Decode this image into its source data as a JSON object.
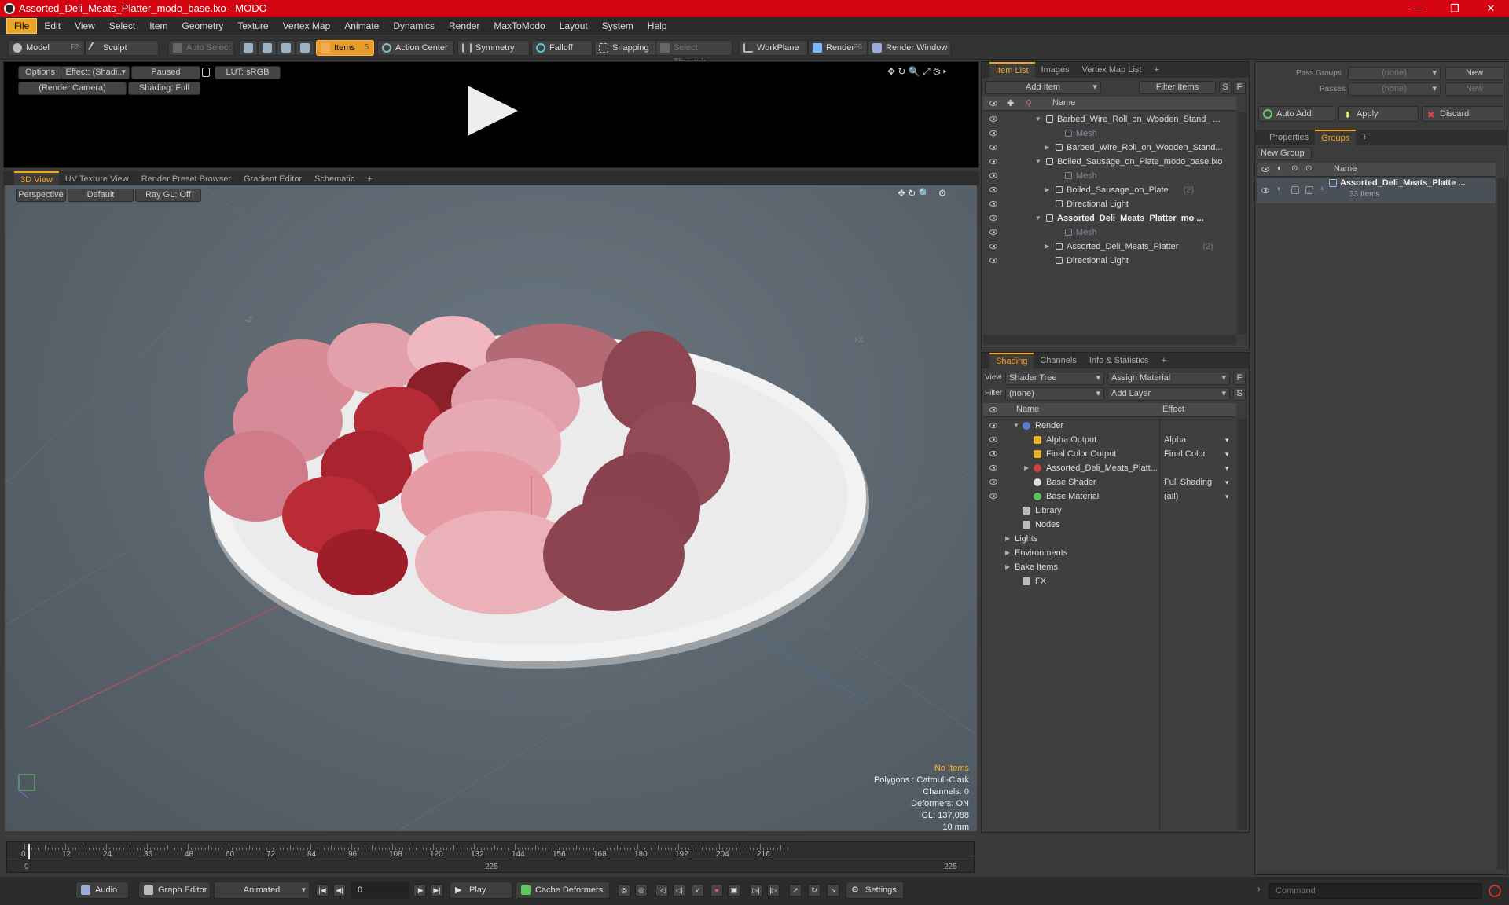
{
  "window": {
    "title": "Assorted_Deli_Meats_Platter_modo_base.lxo - MODO",
    "controls": [
      "—",
      "❐",
      "✕"
    ]
  },
  "menu": [
    "File",
    "Edit",
    "View",
    "Select",
    "Item",
    "Geometry",
    "Texture",
    "Vertex Map",
    "Animate",
    "Dynamics",
    "Render",
    "MaxToModo",
    "Layout",
    "System",
    "Help"
  ],
  "toolbar": {
    "model": "Model",
    "model_key": "F2",
    "sculpt": "Sculpt",
    "auto_select": "Auto Select",
    "items": "Items",
    "items_key": "5",
    "action_center": "Action Center",
    "symmetry": "Symmetry",
    "falloff": "Falloff",
    "snapping": "Snapping",
    "select_through": "Select Through",
    "workplane": "WorkPlane",
    "render": "Render",
    "render_key": "F9",
    "render_window": "Render Window"
  },
  "preview": {
    "options": "Options",
    "effect": "Effect: (Shadi...",
    "paused": "Paused",
    "lut": "LUT: sRGB",
    "camera": "(Render Camera)",
    "shading": "Shading: Full"
  },
  "viewtabs": [
    "3D View",
    "UV Texture View",
    "Render Preset Browser",
    "Gradient Editor",
    "Schematic",
    "+"
  ],
  "viewport": {
    "perspective": "Perspective",
    "default": "Default",
    "raygl": "Ray GL: Off",
    "axis_z": "-Z",
    "axis_x": "+X",
    "stats": {
      "no_items": "No Items",
      "polygons": "Polygons : Catmull-Clark",
      "channels": "Channels: 0",
      "deformers": "Deformers: ON",
      "gl": "GL: 137,088",
      "unit": "10 mm"
    }
  },
  "timeline": {
    "ticks": [
      "0",
      "12",
      "24",
      "36",
      "48",
      "60",
      "72",
      "84",
      "96",
      "108",
      "120",
      "132",
      "144",
      "156",
      "168",
      "180",
      "192",
      "204",
      "216"
    ],
    "start": "0",
    "mid": "225",
    "end": "225"
  },
  "bottom": {
    "audio": "Audio",
    "graph_editor": "Graph Editor",
    "animated": "Animated",
    "frame": "0",
    "play": "Play",
    "cache_deformers": "Cache Deformers",
    "settings": "Settings",
    "command_placeholder": "Command"
  },
  "itemlist": {
    "tabs": [
      "Item List",
      "Images",
      "Vertex Map List",
      "+"
    ],
    "add_item": "Add Item",
    "filter_items": "Filter Items",
    "col_name": "Name",
    "rows": [
      {
        "label": "Barbed_Wire_Roll_on_Wooden_Stand_ ...",
        "indent": 0,
        "arrow": "▼",
        "dim": false,
        "bold": false,
        "count": ""
      },
      {
        "label": "Mesh",
        "indent": 2,
        "arrow": "",
        "dim": true,
        "bold": false,
        "count": ""
      },
      {
        "label": "Barbed_Wire_Roll_on_Wooden_Stand...",
        "indent": 1,
        "arrow": "▶",
        "dim": false,
        "bold": false,
        "count": ""
      },
      {
        "label": "Boiled_Sausage_on_Plate_modo_base.lxo",
        "indent": 0,
        "arrow": "▼",
        "dim": false,
        "bold": false,
        "count": ""
      },
      {
        "label": "Mesh",
        "indent": 2,
        "arrow": "",
        "dim": true,
        "bold": false,
        "count": ""
      },
      {
        "label": "Boiled_Sausage_on_Plate",
        "indent": 1,
        "arrow": "▶",
        "dim": false,
        "bold": false,
        "count": "(2)"
      },
      {
        "label": "Directional Light",
        "indent": 1,
        "arrow": "",
        "dim": false,
        "bold": false,
        "count": ""
      },
      {
        "label": "Assorted_Deli_Meats_Platter_mo ...",
        "indent": 0,
        "arrow": "▼",
        "dim": false,
        "bold": true,
        "count": ""
      },
      {
        "label": "Mesh",
        "indent": 2,
        "arrow": "",
        "dim": true,
        "bold": false,
        "count": ""
      },
      {
        "label": "Assorted_Deli_Meats_Platter",
        "indent": 1,
        "arrow": "▶",
        "dim": false,
        "bold": false,
        "count": "(2)"
      },
      {
        "label": "Directional Light",
        "indent": 1,
        "arrow": "",
        "dim": false,
        "bold": false,
        "count": ""
      }
    ]
  },
  "shading": {
    "tabs": [
      "Shading",
      "Channels",
      "Info & Statistics",
      "+"
    ],
    "view_label": "View",
    "view_value": "Shader Tree",
    "assign_material": "Assign Material",
    "filter_label": "Filter",
    "filter_value": "(none)",
    "add_layer": "Add Layer",
    "col_name": "Name",
    "col_effect": "Effect",
    "rows": [
      {
        "label": "Render",
        "effect": "",
        "indent": 0
      },
      {
        "label": "Alpha Output",
        "effect": "Alpha",
        "indent": 1
      },
      {
        "label": "Final Color Output",
        "effect": "Final Color",
        "indent": 1
      },
      {
        "label": "Assorted_Deli_Meats_Platt...",
        "effect": "",
        "indent": 1
      },
      {
        "label": "Base Shader",
        "effect": "Full Shading",
        "indent": 1
      },
      {
        "label": "Base Material",
        "effect": "(all)",
        "indent": 1
      },
      {
        "label": "Library",
        "effect": "",
        "indent": 0
      },
      {
        "label": "Nodes",
        "effect": "",
        "indent": 0
      },
      {
        "label": "Lights",
        "effect": "",
        "indent": -1
      },
      {
        "label": "Environments",
        "effect": "",
        "indent": -1
      },
      {
        "label": "Bake Items",
        "effect": "",
        "indent": -1
      },
      {
        "label": "FX",
        "effect": "",
        "indent": 0
      }
    ]
  },
  "groups": {
    "pass_groups": "Pass Groups",
    "passes": "Passes",
    "none": "(none)",
    "new": "New",
    "auto_add": "Auto Add",
    "apply": "Apply",
    "discard": "Discard",
    "tabs": [
      "Properties",
      "Groups",
      "+"
    ],
    "new_group": "New Group",
    "col_name": "Name",
    "group_name": "Assorted_Deli_Meats_Platte ...",
    "group_count": "33 Items"
  }
}
